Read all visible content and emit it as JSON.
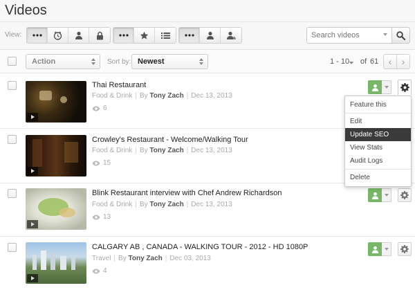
{
  "page": {
    "title": "Videos"
  },
  "toolbar": {
    "view_label": "View:",
    "search_placeholder": "Search videos",
    "groups": [
      {
        "buttons": [
          "more-icon",
          "clock-icon",
          "user-icon",
          "lock-icon"
        ],
        "active": 0
      },
      {
        "buttons": [
          "more-icon",
          "star-icon",
          "list-icon"
        ],
        "active": 0
      },
      {
        "buttons": [
          "more-icon",
          "user-icon",
          "users-icon"
        ],
        "active": 0
      }
    ]
  },
  "filterbar": {
    "action_label": "Action",
    "sortby_label": "Sort by:",
    "sort_value": "Newest",
    "range": "1 - 10",
    "of_label": "of",
    "total": "61"
  },
  "videos": [
    {
      "title": "Thai Restaurant",
      "category": "Food & Drink",
      "by": "By",
      "author": "Tony Zach",
      "date": "Dec 13, 2013",
      "views": "6"
    },
    {
      "title": "Crowley's Restaurant - Welcome/Walking Tour",
      "category": "Food & Drink",
      "by": "By",
      "author": "Tony Zach",
      "date": "Dec 13, 2013",
      "views": "15"
    },
    {
      "title": "Blink Restaurant interview with Chef Andrew Richardson",
      "category": "Food & Drink",
      "by": "By",
      "author": "Tony Zach",
      "date": "Dec 13, 2013",
      "views": "13"
    },
    {
      "title": "CALGARY AB , CANADA - WALKING TOUR - 2012 - HD 1080P",
      "category": "Travel",
      "by": "By",
      "author": "Tony Zach",
      "date": "Dec 03, 2013",
      "views": "4"
    }
  ],
  "menu": {
    "items": [
      "Feature this",
      "Edit",
      "Update SEO",
      "View Stats",
      "Audit Logs",
      "Delete"
    ],
    "highlighted": "Update SEO"
  },
  "colors": {
    "accent_green": "#77b767",
    "menu_highlight": "#3a3a3a"
  }
}
